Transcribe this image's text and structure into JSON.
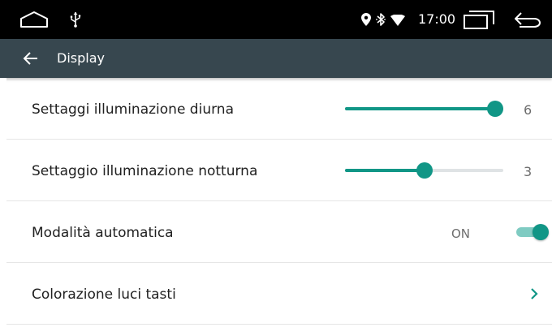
{
  "status_bar": {
    "time": "17:00",
    "icons": [
      "home-icon",
      "usb-icon",
      "location-icon",
      "bluetooth-icon",
      "wifi-icon",
      "recent-apps-icon",
      "back-icon"
    ]
  },
  "app_bar": {
    "title": "Display",
    "back_icon": "arrow-left-icon"
  },
  "settings": {
    "items": [
      {
        "label": "Settaggi illuminazione diurna",
        "value": "6",
        "slider_level": 6,
        "slider_max": 6
      },
      {
        "label": "Settaggio illuminazione notturna",
        "value": "3",
        "slider_level": 3,
        "slider_max": 6
      },
      {
        "label": "Modalità automatica",
        "state": "ON"
      },
      {
        "label": "Colorazione luci tasti",
        "icon": "chevron-right-icon"
      }
    ]
  },
  "colors": {
    "accent": "#119686",
    "app_bar": "#37474f",
    "status_bar": "#000000",
    "switch_track": "#7fcbc2"
  }
}
